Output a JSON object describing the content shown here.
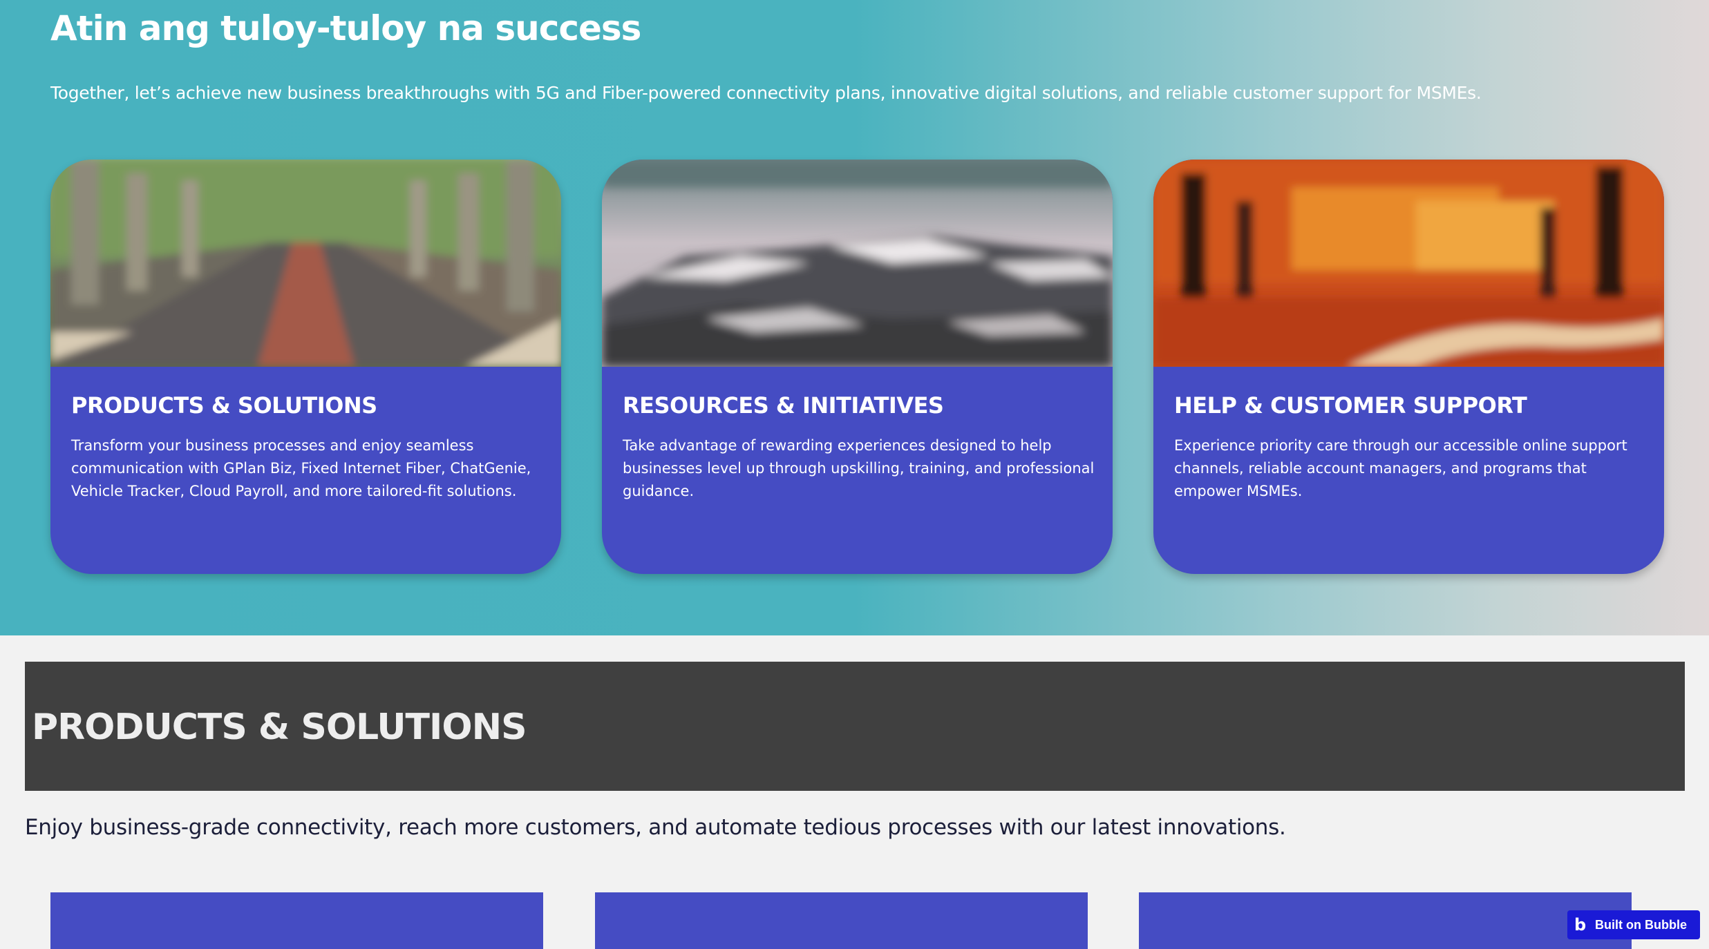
{
  "hero": {
    "title": "Atin ang tuloy-tuloy na success",
    "subtitle": "Together, let’s achieve new business breakthroughs with 5G and Fiber-powered connectivity plans, innovative digital solutions, and reliable customer support for MSMEs."
  },
  "cards": [
    {
      "title": "PRODUCTS & SOLUTIONS",
      "body": "Transform your business processes and enjoy seamless communication with GPlan Biz, Fixed Internet Fiber, ChatGenie, Vehicle Tracker, Cloud Payroll, and more tailored-fit solutions.",
      "image": "tree-lined-road-photo"
    },
    {
      "title": "RESOURCES & INITIATIVES",
      "body": "Take advantage of rewarding experiences designed to help businesses level up through upskilling, training, and professional guidance.",
      "image": "snowy-mountains-photo"
    },
    {
      "title": "HELP & CUSTOMER SUPPORT",
      "body": "Experience priority care through our accessible online support channels, reliable account managers, and programs that empower MSMEs.",
      "image": "autumn-forest-photo"
    }
  ],
  "section": {
    "title": "PRODUCTS & SOLUTIONS",
    "subtitle": "Enjoy business-grade connectivity, reach more customers, and automate tedious processes with our latest innovations."
  },
  "badge": {
    "label": "Built on Bubble",
    "icon": "bubble-logo-icon"
  },
  "colors": {
    "card_bg": "#454cc3",
    "hero_teal": "#48b2bf",
    "band_bg": "#404040",
    "badge_bg": "#1a1ad6"
  }
}
